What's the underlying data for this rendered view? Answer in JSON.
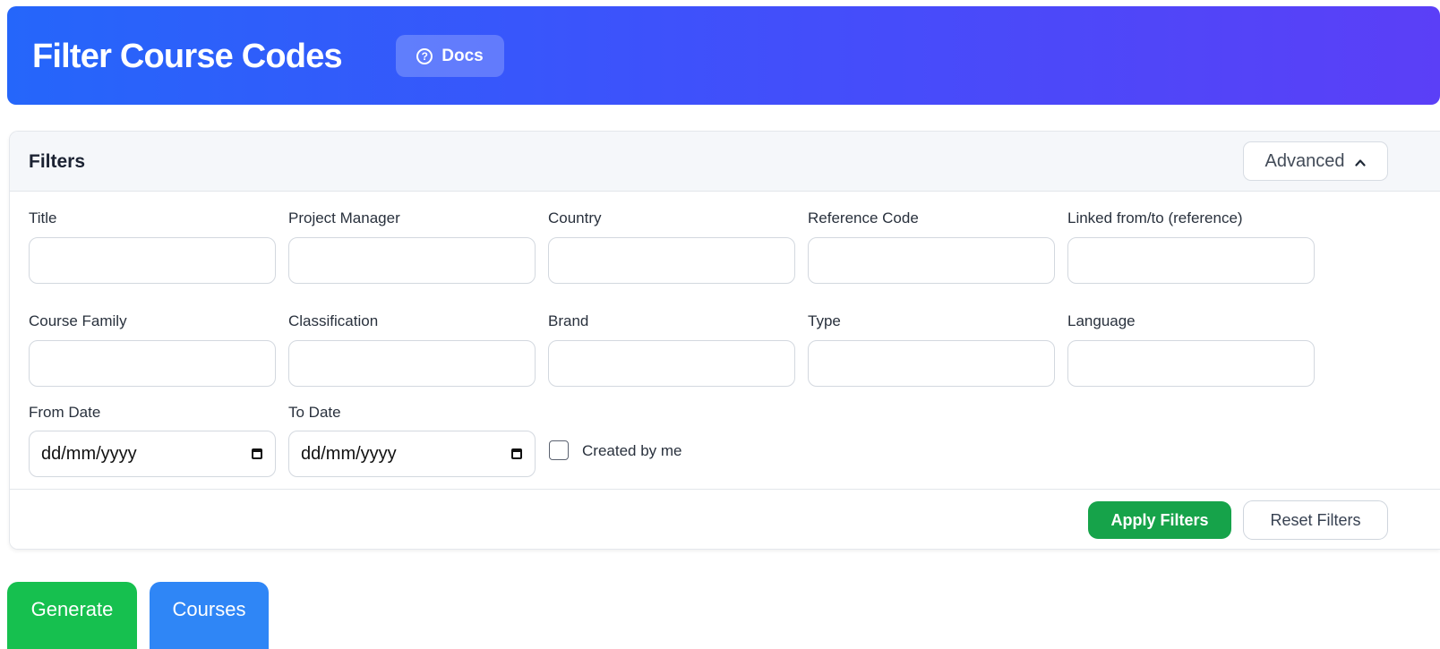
{
  "header": {
    "title": "Filter Course Codes",
    "docs_label": "Docs",
    "gradient_colors": [
      "#2566fa",
      "#5b3ff7"
    ]
  },
  "filters": {
    "title": "Filters",
    "advanced_label": "Advanced",
    "advanced_state": "expanded",
    "fields": {
      "title": {
        "label": "Title",
        "value": ""
      },
      "project_manager": {
        "label": "Project Manager",
        "value": ""
      },
      "country": {
        "label": "Country",
        "value": ""
      },
      "reference_code": {
        "label": "Reference Code",
        "value": ""
      },
      "linked_reference": {
        "label": "Linked from/to (reference)",
        "value": ""
      },
      "course_family": {
        "label": "Course Family",
        "value": ""
      },
      "classification": {
        "label": "Classification",
        "value": ""
      },
      "brand": {
        "label": "Brand",
        "value": ""
      },
      "type": {
        "label": "Type",
        "value": ""
      },
      "language": {
        "label": "Language",
        "value": ""
      },
      "from_date": {
        "label": "From Date",
        "placeholder": "dd/mm/yyyy"
      },
      "to_date": {
        "label": "To Date",
        "placeholder": "dd/mm/yyyy"
      }
    },
    "created_by_me": {
      "label": "Created by me",
      "checked": false
    },
    "apply_label": "Apply Filters",
    "reset_label": "Reset Filters"
  },
  "actions": {
    "generate_label": "Generate",
    "courses_label": "Courses"
  },
  "colors": {
    "apply": "#16a34a",
    "generate": "#16c04f",
    "courses": "#2f86f6"
  }
}
